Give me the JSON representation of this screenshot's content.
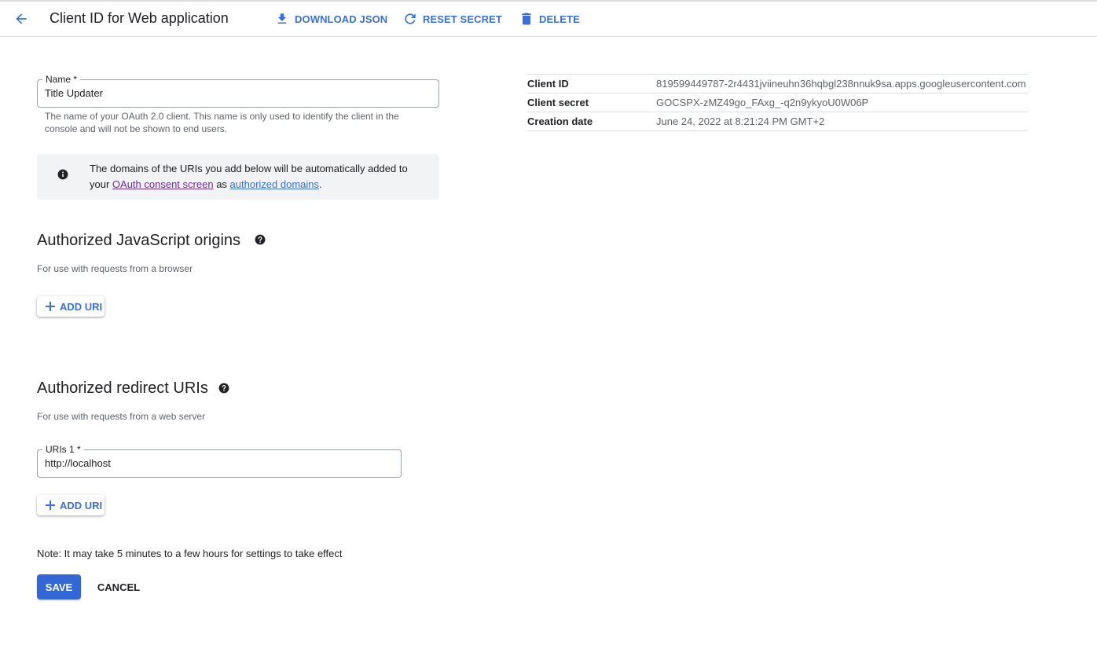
{
  "header": {
    "title": "Client ID for Web application",
    "actions": {
      "download": "DOWNLOAD JSON",
      "reset": "RESET SECRET",
      "delete": "DELETE"
    }
  },
  "form": {
    "name": {
      "label": "Name *",
      "value": "Title Updater",
      "hint": "The name of your OAuth 2.0 client. This name is only used to identify the client in the console and will not be shown to end users."
    },
    "info": {
      "text_before": "The domains of the URIs you add below will be automatically added to your",
      "link1": "OAuth consent screen",
      "text_middle": "as",
      "link2": "authorized domains",
      "text_after": "."
    },
    "js_origins": {
      "title": "Authorized JavaScript origins",
      "description": "For use with requests from a browser",
      "add_label": "ADD URI"
    },
    "redirect_uris": {
      "title": "Authorized redirect URIs",
      "description": "For use with requests from a web server",
      "uri_label": "URIs 1 *",
      "uri_value": "http://localhost",
      "add_label": "ADD URI"
    },
    "note": "Note: It may take 5 minutes to a few hours for settings to take effect",
    "save_label": "SAVE",
    "cancel_label": "CANCEL"
  },
  "details": [
    {
      "key": "Client ID",
      "value": "819599449787-2r4431jviineuhn36hqbgl238nnuk9sa.apps.googleusercontent.com"
    },
    {
      "key": "Client secret",
      "value": "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"
    },
    {
      "key": "Creation date",
      "value": "June 24, 2022 at 8:21:24 PM GMT+2"
    }
  ],
  "icons": {
    "back": "arrow-back-icon",
    "download": "download-icon",
    "reset": "refresh-icon",
    "delete": "trash-icon",
    "info": "info-icon",
    "help": "help-icon",
    "add": "plus-icon"
  },
  "colors": {
    "accent": "#3b6fd6",
    "primary_button": "#3367d6",
    "visited_link": "#6a2d9c",
    "info_background": "#f1f3f4"
  }
}
